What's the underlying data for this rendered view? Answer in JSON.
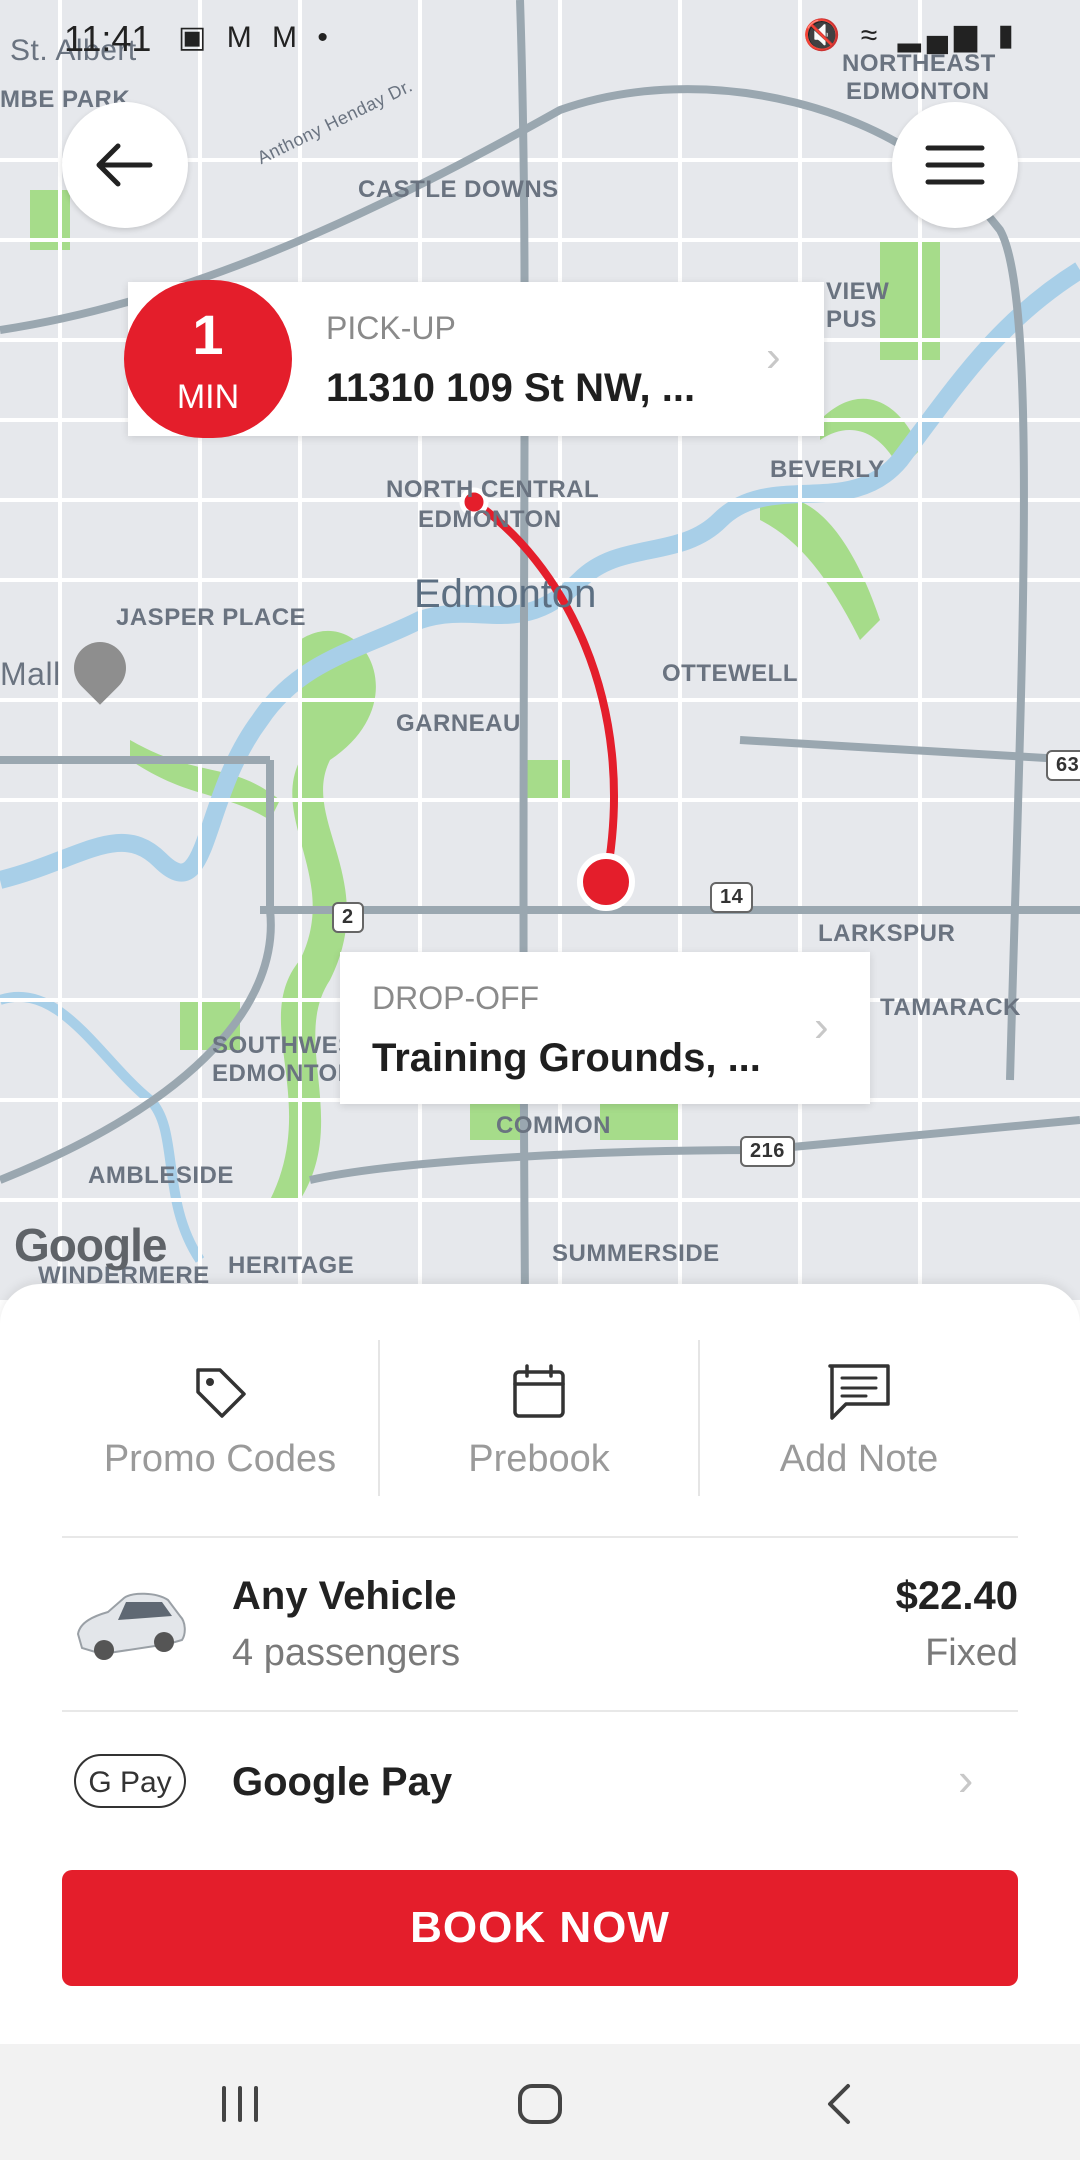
{
  "status_bar": {
    "time": "11:41",
    "left_icons": [
      "image-icon",
      "gmail-icon",
      "gmail-icon",
      "dot-icon"
    ],
    "right_icons": [
      "mute-icon",
      "wifi-icon",
      "signal-icon",
      "battery-icon"
    ]
  },
  "map": {
    "labels": [
      "St. Albert",
      "MBE PARK",
      "NORTHEAST",
      "EDMONTON",
      "Anthony Henday Dr.",
      "CASTLE DOWNS",
      "VIEW",
      "PUS",
      "BEVERLY",
      "NORTH CENTRAL",
      "EDMONTON",
      "JASPER PLACE",
      "Mall",
      "OTTEWELL",
      "GARNEAU",
      "LARKSPUR",
      "TAMARACK",
      "SOUTHWEST",
      "EDMONTON",
      "COMMON",
      "AMBLESIDE",
      "WINDERMERE",
      "HERITAGE",
      "SUMMERSIDE",
      "2",
      "14",
      "216",
      "63"
    ],
    "city": "Edmonton",
    "attribution": "Google",
    "colors": {
      "route": "#e41e2b",
      "water": "#a8cfe8",
      "park": "#a6dc8a",
      "road": "#ffffff",
      "highway": "#9aa7b0"
    }
  },
  "pickup": {
    "eta_value": "1",
    "eta_unit": "MIN",
    "caption": "PICK-UP",
    "address": "11310 109 St NW, ..."
  },
  "dropoff": {
    "caption": "DROP-OFF",
    "address": "Training Grounds, ..."
  },
  "actions": [
    {
      "label": "Promo Codes",
      "icon": "tag-icon"
    },
    {
      "label": "Prebook",
      "icon": "calendar-icon"
    },
    {
      "label": "Add Note",
      "icon": "note-icon"
    }
  ],
  "vehicle": {
    "name": "Any Vehicle",
    "capacity": "4 passengers",
    "price": "$22.40",
    "price_type": "Fixed"
  },
  "payment": {
    "badge": "G Pay",
    "name": "Google Pay"
  },
  "book_button": "BOOK NOW",
  "nav": [
    "recent-apps-icon",
    "home-icon",
    "back-icon"
  ],
  "accent_color": "#e41e2b"
}
